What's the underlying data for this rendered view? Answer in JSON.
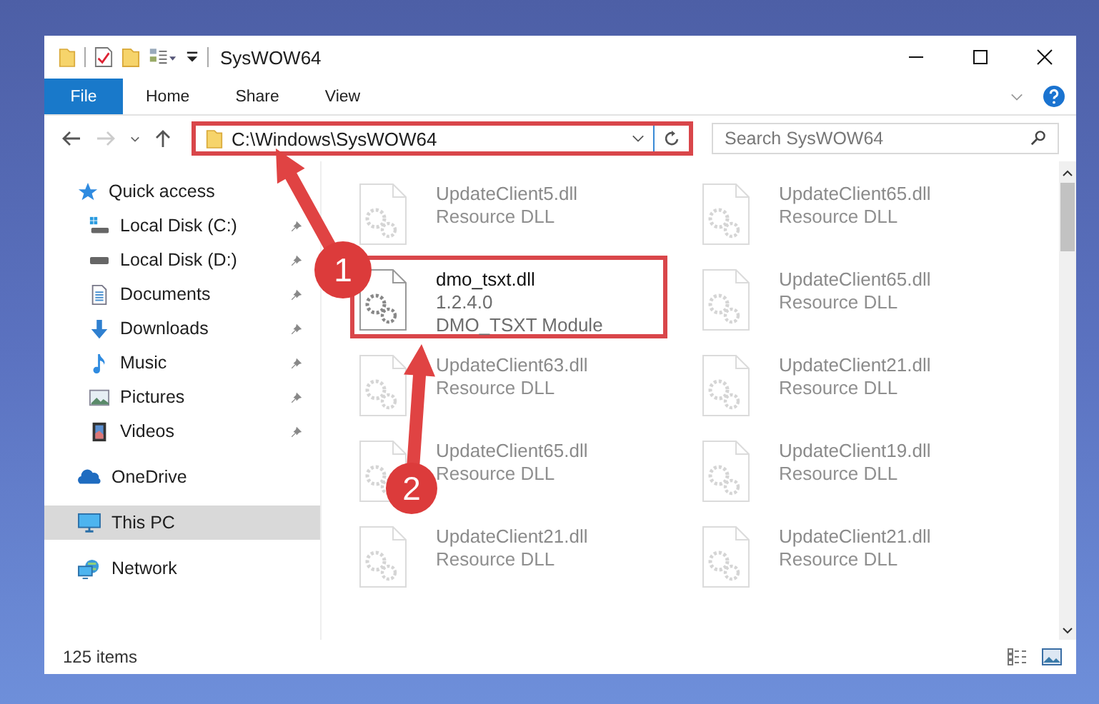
{
  "window": {
    "title": "SysWOW64"
  },
  "ribbon_tabs": [
    {
      "label": "File",
      "kind": "menu"
    },
    {
      "label": "Home",
      "kind": "tab"
    },
    {
      "label": "Share",
      "kind": "tab"
    },
    {
      "label": "View",
      "kind": "tab"
    }
  ],
  "navigation": {
    "forward_disabled": true
  },
  "address_bar": {
    "path": "C:\\Windows\\SysWOW64",
    "highlighted": true
  },
  "search": {
    "placeholder": "Search SysWOW64"
  },
  "sidebar": {
    "items": [
      {
        "label": "Quick access",
        "selected": false,
        "children": [
          {
            "label": "Local Disk (C:)",
            "pinned": true,
            "selected": false
          },
          {
            "label": "Local Disk (D:)",
            "pinned": true,
            "selected": false
          },
          {
            "label": "Documents",
            "pinned": true,
            "selected": false
          },
          {
            "label": "Downloads",
            "pinned": true,
            "selected": false
          },
          {
            "label": "Music",
            "pinned": true,
            "selected": false
          },
          {
            "label": "Pictures",
            "pinned": true,
            "selected": false
          },
          {
            "label": "Videos",
            "pinned": true,
            "selected": false
          }
        ]
      },
      {
        "label": "OneDrive",
        "selected": false
      },
      {
        "label": "This PC",
        "selected": true
      },
      {
        "label": "Network",
        "selected": false
      }
    ]
  },
  "files": [
    {
      "name": "UpdateClient5.dll",
      "details": [
        "Resource DLL"
      ],
      "blurred": true,
      "highlighted": false
    },
    {
      "name": "UpdateClient65.dll",
      "details": [
        "Resource DLL"
      ],
      "blurred": true,
      "highlighted": false
    },
    {
      "name": "dmo_tsxt.dll",
      "details": [
        "1.2.4.0",
        "DMO_TSXT Module"
      ],
      "blurred": false,
      "highlighted": true
    },
    {
      "name": "UpdateClient65.dll",
      "details": [
        "Resource DLL"
      ],
      "blurred": true,
      "highlighted": false
    },
    {
      "name": "UpdateClient63.dll",
      "details": [
        "Resource DLL"
      ],
      "blurred": true,
      "highlighted": false
    },
    {
      "name": "UpdateClient21.dll",
      "details": [
        "Resource DLL"
      ],
      "blurred": true,
      "highlighted": false
    },
    {
      "name": "UpdateClient65.dll",
      "details": [
        "Resource DLL"
      ],
      "blurred": true,
      "highlighted": false
    },
    {
      "name": "UpdateClient19.dll",
      "details": [
        "Resource DLL"
      ],
      "blurred": true,
      "highlighted": false
    },
    {
      "name": "UpdateClient21.dll",
      "details": [
        "Resource DLL"
      ],
      "blurred": true,
      "highlighted": false
    },
    {
      "name": "UpdateClient21.dll",
      "details": [
        "Resource DLL"
      ],
      "blurred": true,
      "highlighted": false
    }
  ],
  "annotations": [
    {
      "number": "1"
    },
    {
      "number": "2"
    }
  ],
  "status_bar": {
    "item_count": "125 items"
  }
}
